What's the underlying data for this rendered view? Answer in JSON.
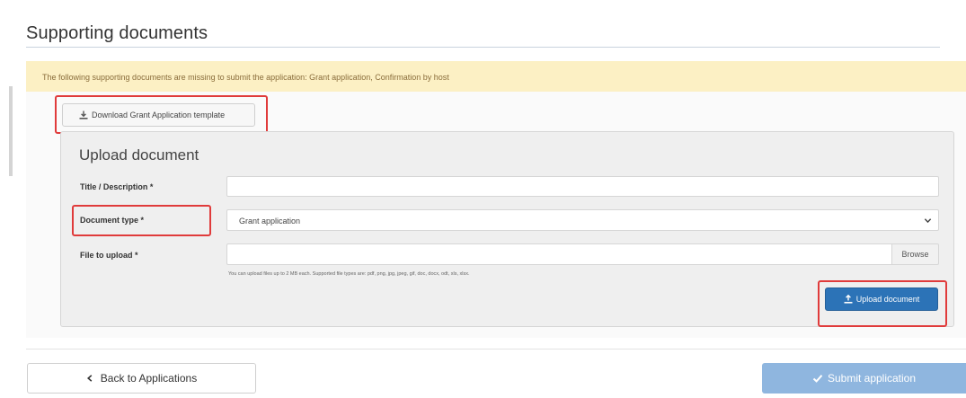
{
  "page": {
    "title": "Supporting documents",
    "alert_text": "The following supporting documents are missing to submit the application: Grant application, Confirmation by host"
  },
  "download_template": {
    "label": "Download Grant Application template",
    "icon": "download-icon"
  },
  "upload_panel": {
    "title": "Upload document",
    "fields": {
      "title_description": {
        "label": "Title / Description *",
        "value": ""
      },
      "document_type": {
        "label": "Document type *",
        "value": "Grant application"
      },
      "file_to_upload": {
        "label": "File to upload *",
        "value": "",
        "browse_label": "Browse"
      }
    },
    "help_text": "You can upload files up to 2 MB each. Supported file types are: pdf, png, jpg, jpeg, gif, doc, docx, odt, xls, xlsx.",
    "upload_button_label": "Upload document",
    "upload_icon": "upload-icon"
  },
  "footer": {
    "back_label": "Back to Applications",
    "submit_label": "Submit application",
    "submit_icon": "checkmark-icon"
  },
  "colors": {
    "alert_bg": "#fcf0c4",
    "highlight": "#e03b3b",
    "primary": "#2c73b7",
    "submit_disabled": "#8fb6df"
  }
}
